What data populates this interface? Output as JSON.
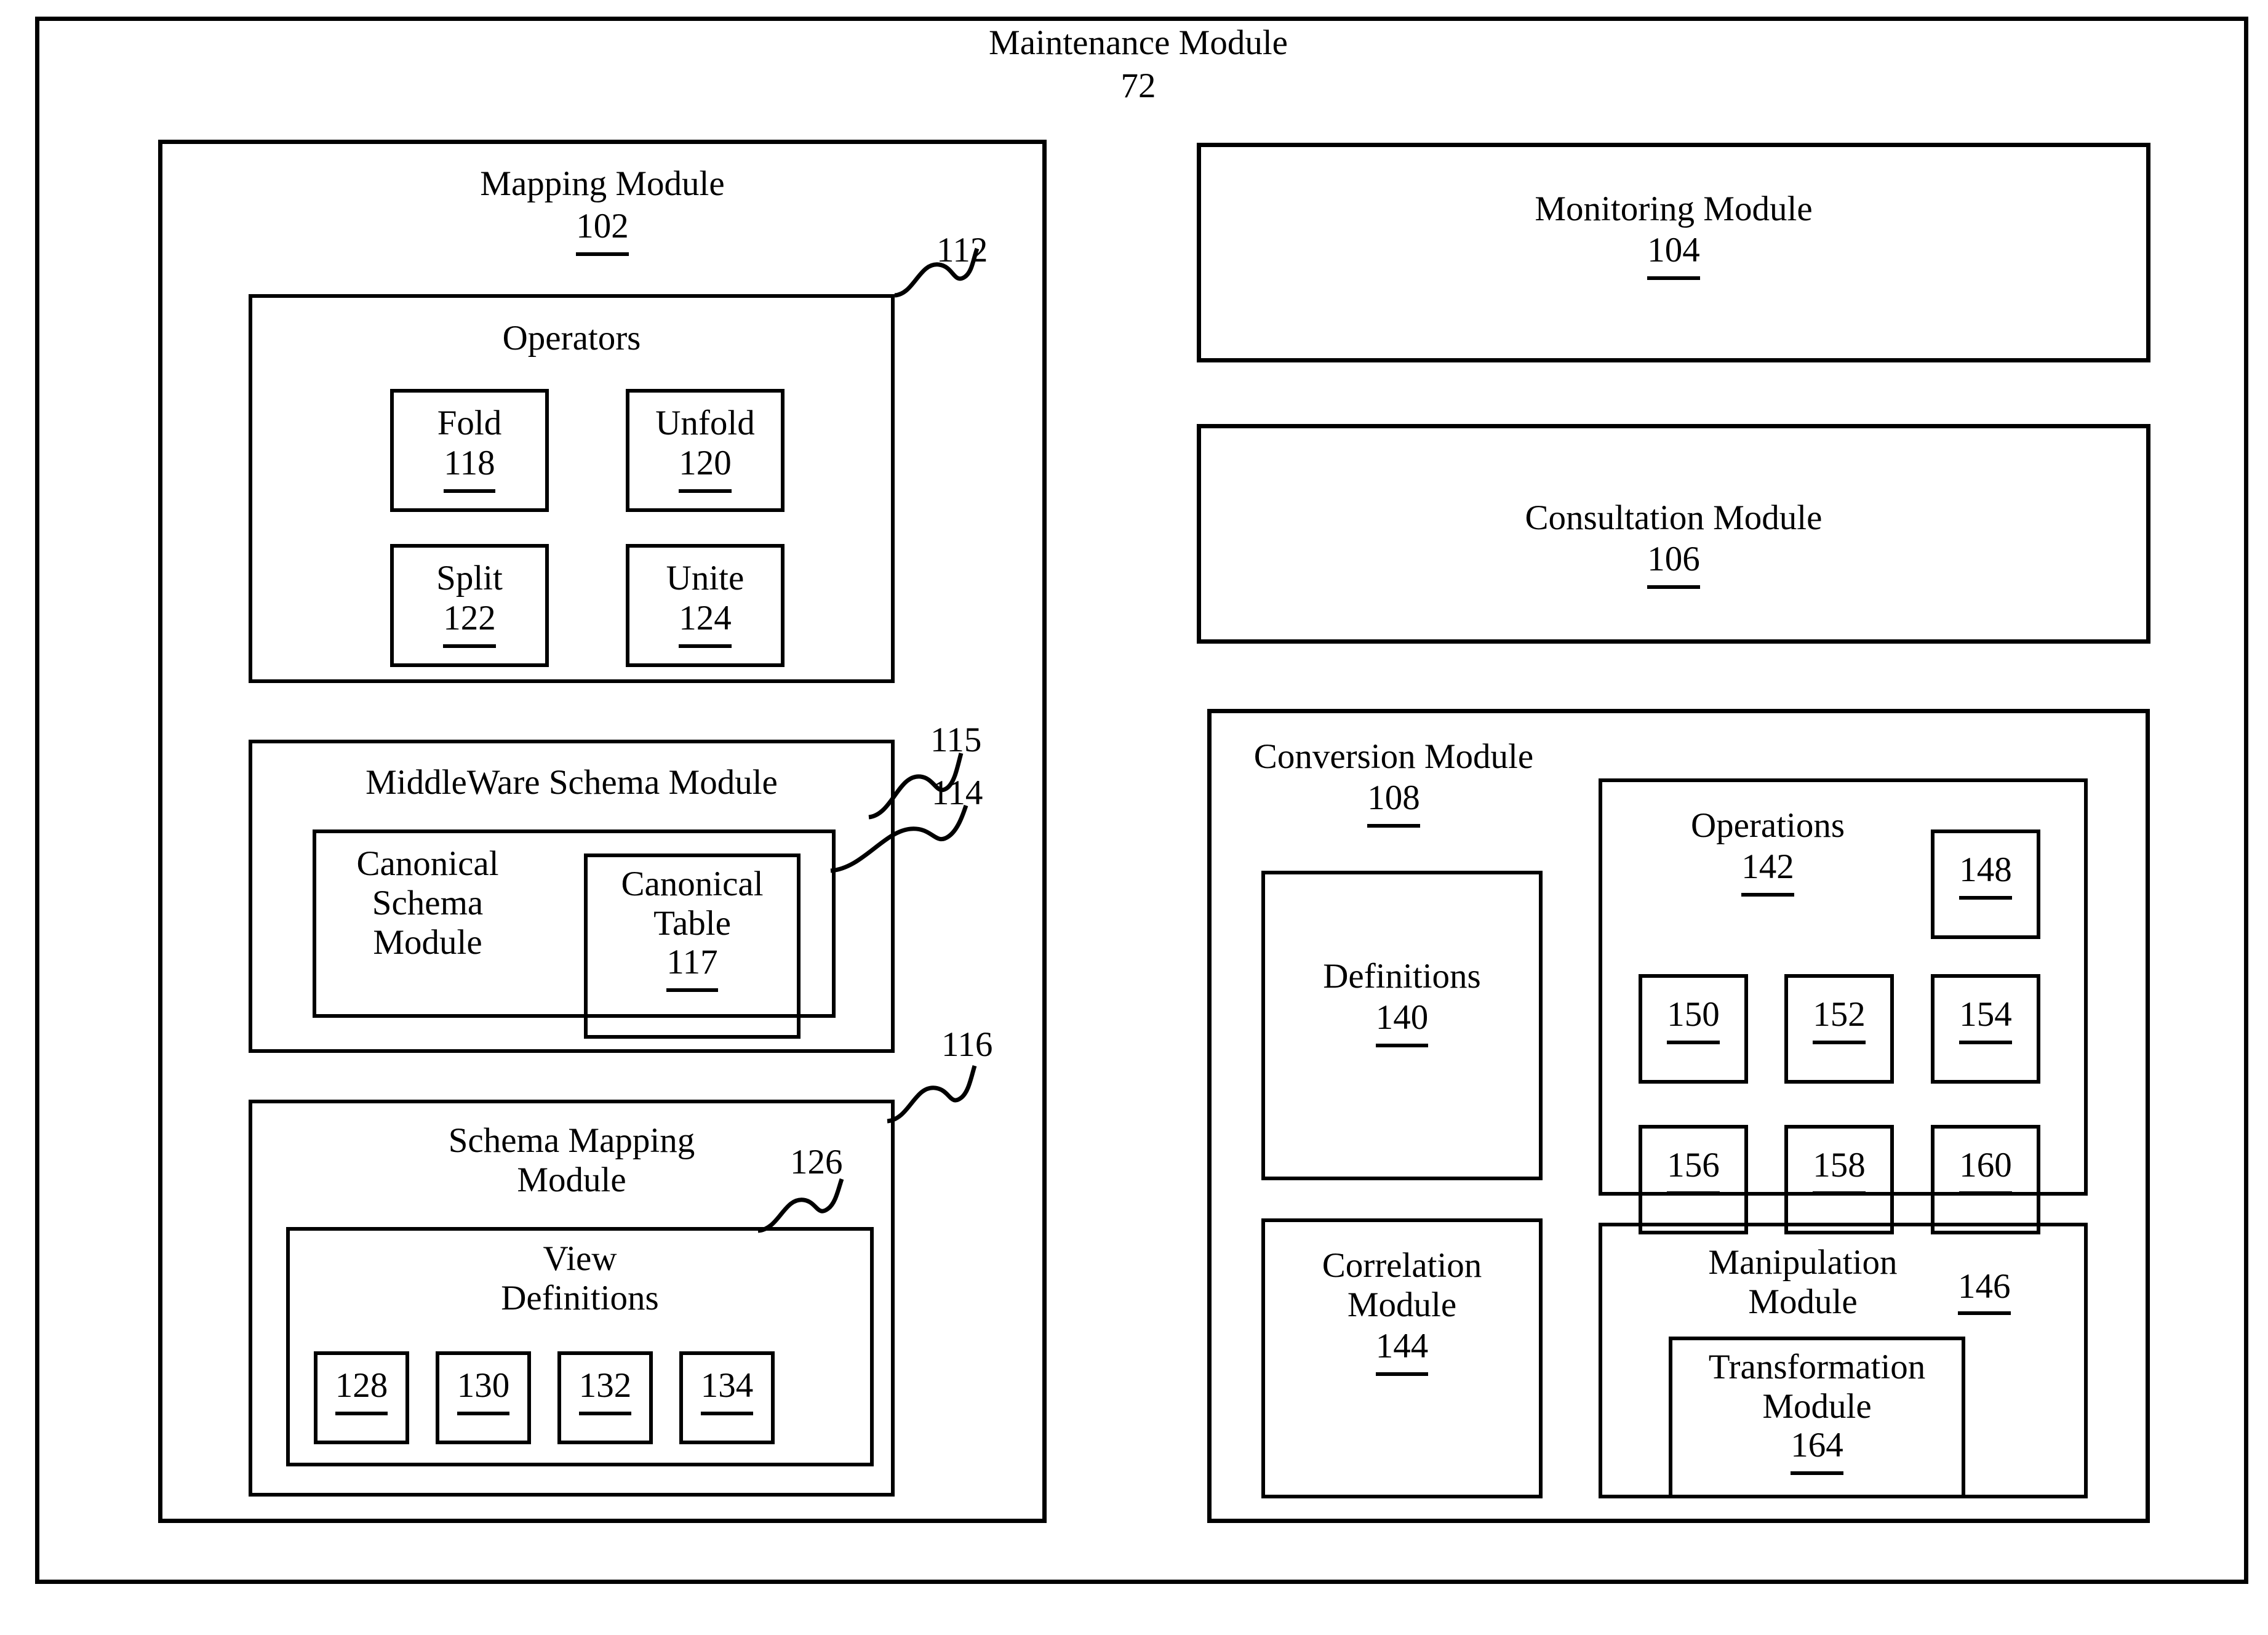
{
  "figure": {
    "outer": {
      "title": "Maintenance Module",
      "ref": "72"
    },
    "mapping_module": {
      "title": "Mapping Module",
      "ref": "102",
      "operators": {
        "title": "Operators",
        "lead_ref": "112",
        "items": [
          {
            "label": "Fold",
            "ref": "118"
          },
          {
            "label": "Unfold",
            "ref": "120"
          },
          {
            "label": "Split",
            "ref": "122"
          },
          {
            "label": "Unite",
            "ref": "124"
          }
        ]
      },
      "middleware_schema_module": {
        "title": "MiddleWare Schema Module",
        "lead_ref": "115",
        "canonical_schema_module": {
          "title_line1": "Canonical",
          "title_line2": "Schema",
          "title_line3": "Module",
          "lead_ref": "114",
          "canonical_table": {
            "title_line1": "Canonical",
            "title_line2": "Table",
            "ref": "117"
          }
        }
      },
      "schema_mapping_module": {
        "title_line1": "Schema Mapping",
        "title_line2": "Module",
        "lead_ref": "116",
        "view_definitions": {
          "title_line1": "View",
          "title_line2": "Definitions",
          "lead_ref": "126",
          "items": [
            "128",
            "130",
            "132",
            "134"
          ]
        }
      }
    },
    "monitoring_module": {
      "title": "Monitoring Module",
      "ref": "104"
    },
    "consultation_module": {
      "title": "Consultation Module",
      "ref": "106"
    },
    "conversion_module": {
      "title": "Conversion Module",
      "ref": "108",
      "definitions": {
        "title": "Definitions",
        "ref": "140"
      },
      "operations": {
        "title": "Operations",
        "ref": "142",
        "corner_item": "148",
        "grid": [
          "150",
          "152",
          "154",
          "156",
          "158",
          "160"
        ]
      },
      "correlation_module": {
        "title_line1": "Correlation",
        "title_line2": "Module",
        "ref": "144"
      },
      "manipulation_module": {
        "title_line1": "Manipulation",
        "title_line2": "Module",
        "side_ref": "146",
        "transformation_module": {
          "title_line1": "Transformation",
          "title_line2": "Module",
          "ref": "164"
        }
      }
    }
  }
}
